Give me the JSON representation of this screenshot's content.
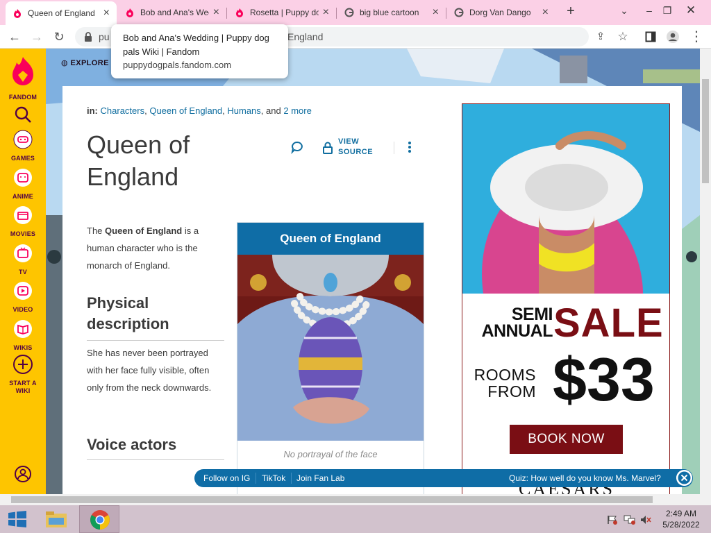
{
  "browser": {
    "tabs": [
      {
        "title": "Queen of England",
        "favicon": "fandom-icon",
        "active": true
      },
      {
        "title": "Bob and Ana's Wedding",
        "favicon": "fandom-icon",
        "active": false
      },
      {
        "title": "Rosetta | Puppy dog pals",
        "favicon": "fandom-icon",
        "active": false
      },
      {
        "title": "big blue cartoon",
        "favicon": "google-icon",
        "active": false
      },
      {
        "title": "Dorg Van Dango",
        "favicon": "google-icon",
        "active": false
      }
    ],
    "address": {
      "left": "pu",
      "right": "England"
    },
    "tooltip": {
      "title": "Bob and Ana's Wedding | Puppy dog pals Wiki | Fandom",
      "domain": "puppydogpals.fandom.com"
    }
  },
  "rail": {
    "brand": "FANDOM",
    "items": [
      "GAMES",
      "ANIME",
      "MOVIES",
      "TV",
      "VIDEO",
      "WIKIS",
      "START A WIKI"
    ]
  },
  "local_nav": {
    "explore": "EXPLORE"
  },
  "article": {
    "categories_prefix": "in:",
    "categories": [
      "Characters",
      "Queen of England",
      "Humans"
    ],
    "categories_more_pre": "and",
    "categories_more": "2 more",
    "title": "Queen of England",
    "view_source": "VIEW SOURCE",
    "intro_pre": "The ",
    "intro_bold": "Queen of England",
    "intro_post": " is a human character who is the monarch of England.",
    "h_physical": "Physical description",
    "physical_text": "She has never been portrayed with her face fully visible, often only from the neck downwards.",
    "h_voice": "Voice actors"
  },
  "infobox": {
    "title": "Queen of England",
    "caption": "No portrayal of the face"
  },
  "ad": {
    "semi": "SEMI",
    "annual": "ANNUAL",
    "sale": "SALE",
    "rooms": "ROOMS",
    "from": "FROM",
    "price": "$33",
    "cta": "BOOK NOW",
    "brand": "CAESARS"
  },
  "fanbar": {
    "links": [
      "Follow on IG",
      "TikTok",
      "Join Fan Lab"
    ],
    "quiz": "Quiz: How well do you know Ms. Marvel?"
  },
  "taskbar": {
    "time": "2:49 AM",
    "date": "5/28/2022"
  },
  "colors": {
    "fandom_yellow": "#fec500",
    "fandom_link": "#0f6d9f",
    "infobox_header": "#0f6da6",
    "ad_red": "#7a0e14",
    "tab_strip": "#fbd0e6"
  }
}
